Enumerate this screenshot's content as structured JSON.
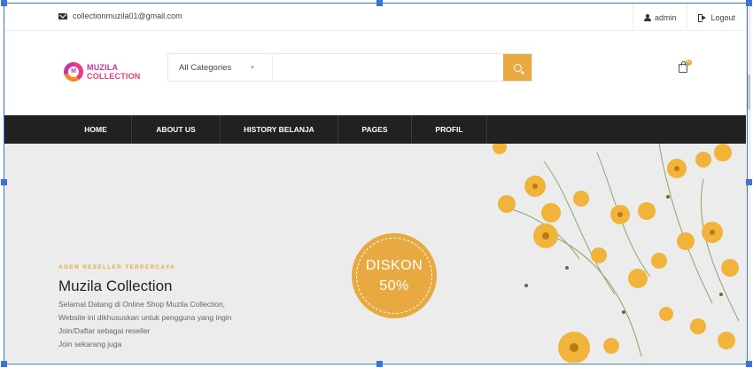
{
  "topbar": {
    "email": "collectionmuzila01@gmail.com",
    "user_label": "admin",
    "logout_label": "Logout"
  },
  "header": {
    "logo_line1": "MUZILA",
    "logo_line2": "COLLECTION",
    "logo_mark": "M",
    "search": {
      "category_selected": "All Categories",
      "placeholder": ""
    },
    "cart_count": "0"
  },
  "nav": {
    "items": [
      {
        "label": "HOME"
      },
      {
        "label": "ABOUT US"
      },
      {
        "label": "HISTORY BELANJA"
      },
      {
        "label": "PAGES"
      },
      {
        "label": "PROFIL"
      }
    ]
  },
  "hero": {
    "tag": "AGEN RESELLER TERPERCAYA",
    "title": "Muzila Collection",
    "desc_lines": [
      "Selamat Datang di Online Shop Muzila Collection,",
      "Website ini dikhususkan untuk pengguna yang ingin",
      "Join/Daftar sebagai reseller",
      "Join sekarang juga"
    ],
    "badge_line1": "DISKON",
    "badge_line2": "50%"
  },
  "colors": {
    "accent": "#e7a940",
    "nav_bg": "#212121",
    "hero_bg": "#ececec",
    "selection": "#3b73d6"
  },
  "icons": {
    "email": "mail-icon",
    "user": "user-icon",
    "logout": "logout-icon",
    "search": "search-icon",
    "cart": "shopping-bag-icon"
  }
}
